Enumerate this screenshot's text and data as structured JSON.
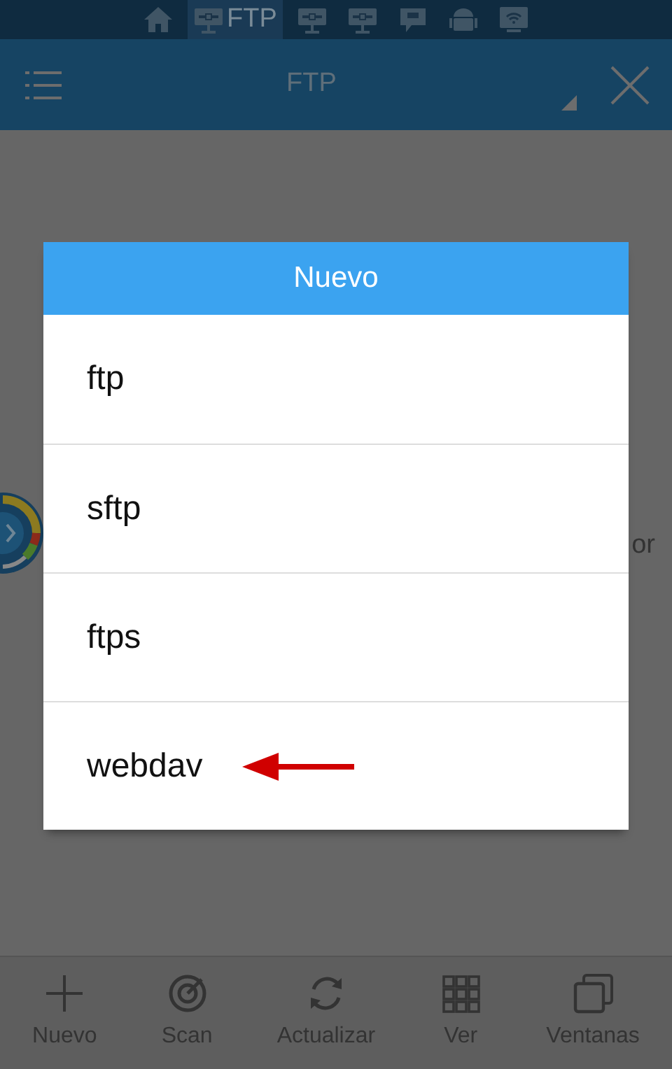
{
  "status_tabs": [
    {
      "kind": "home",
      "selected": false
    },
    {
      "kind": "monitor",
      "label": "FTP",
      "selected": true
    },
    {
      "kind": "monitor",
      "selected": false
    },
    {
      "kind": "monitor",
      "selected": false
    },
    {
      "kind": "sd",
      "selected": false
    },
    {
      "kind": "android",
      "selected": false
    },
    {
      "kind": "wifi",
      "selected": false
    }
  ],
  "header": {
    "title": "FTP"
  },
  "background": {
    "side_text": "or"
  },
  "dialog": {
    "title": "Nuevo",
    "items": [
      {
        "label": "ftp",
        "marked": false
      },
      {
        "label": "sftp",
        "marked": false
      },
      {
        "label": "ftps",
        "marked": false
      },
      {
        "label": "webdav",
        "marked": true
      }
    ]
  },
  "toolbar": [
    {
      "kind": "plus",
      "label": "Nuevo"
    },
    {
      "kind": "scan",
      "label": "Scan"
    },
    {
      "kind": "refresh",
      "label": "Actualizar"
    },
    {
      "kind": "grid",
      "label": "Ver"
    },
    {
      "kind": "windows",
      "label": "Ventanas"
    }
  ]
}
